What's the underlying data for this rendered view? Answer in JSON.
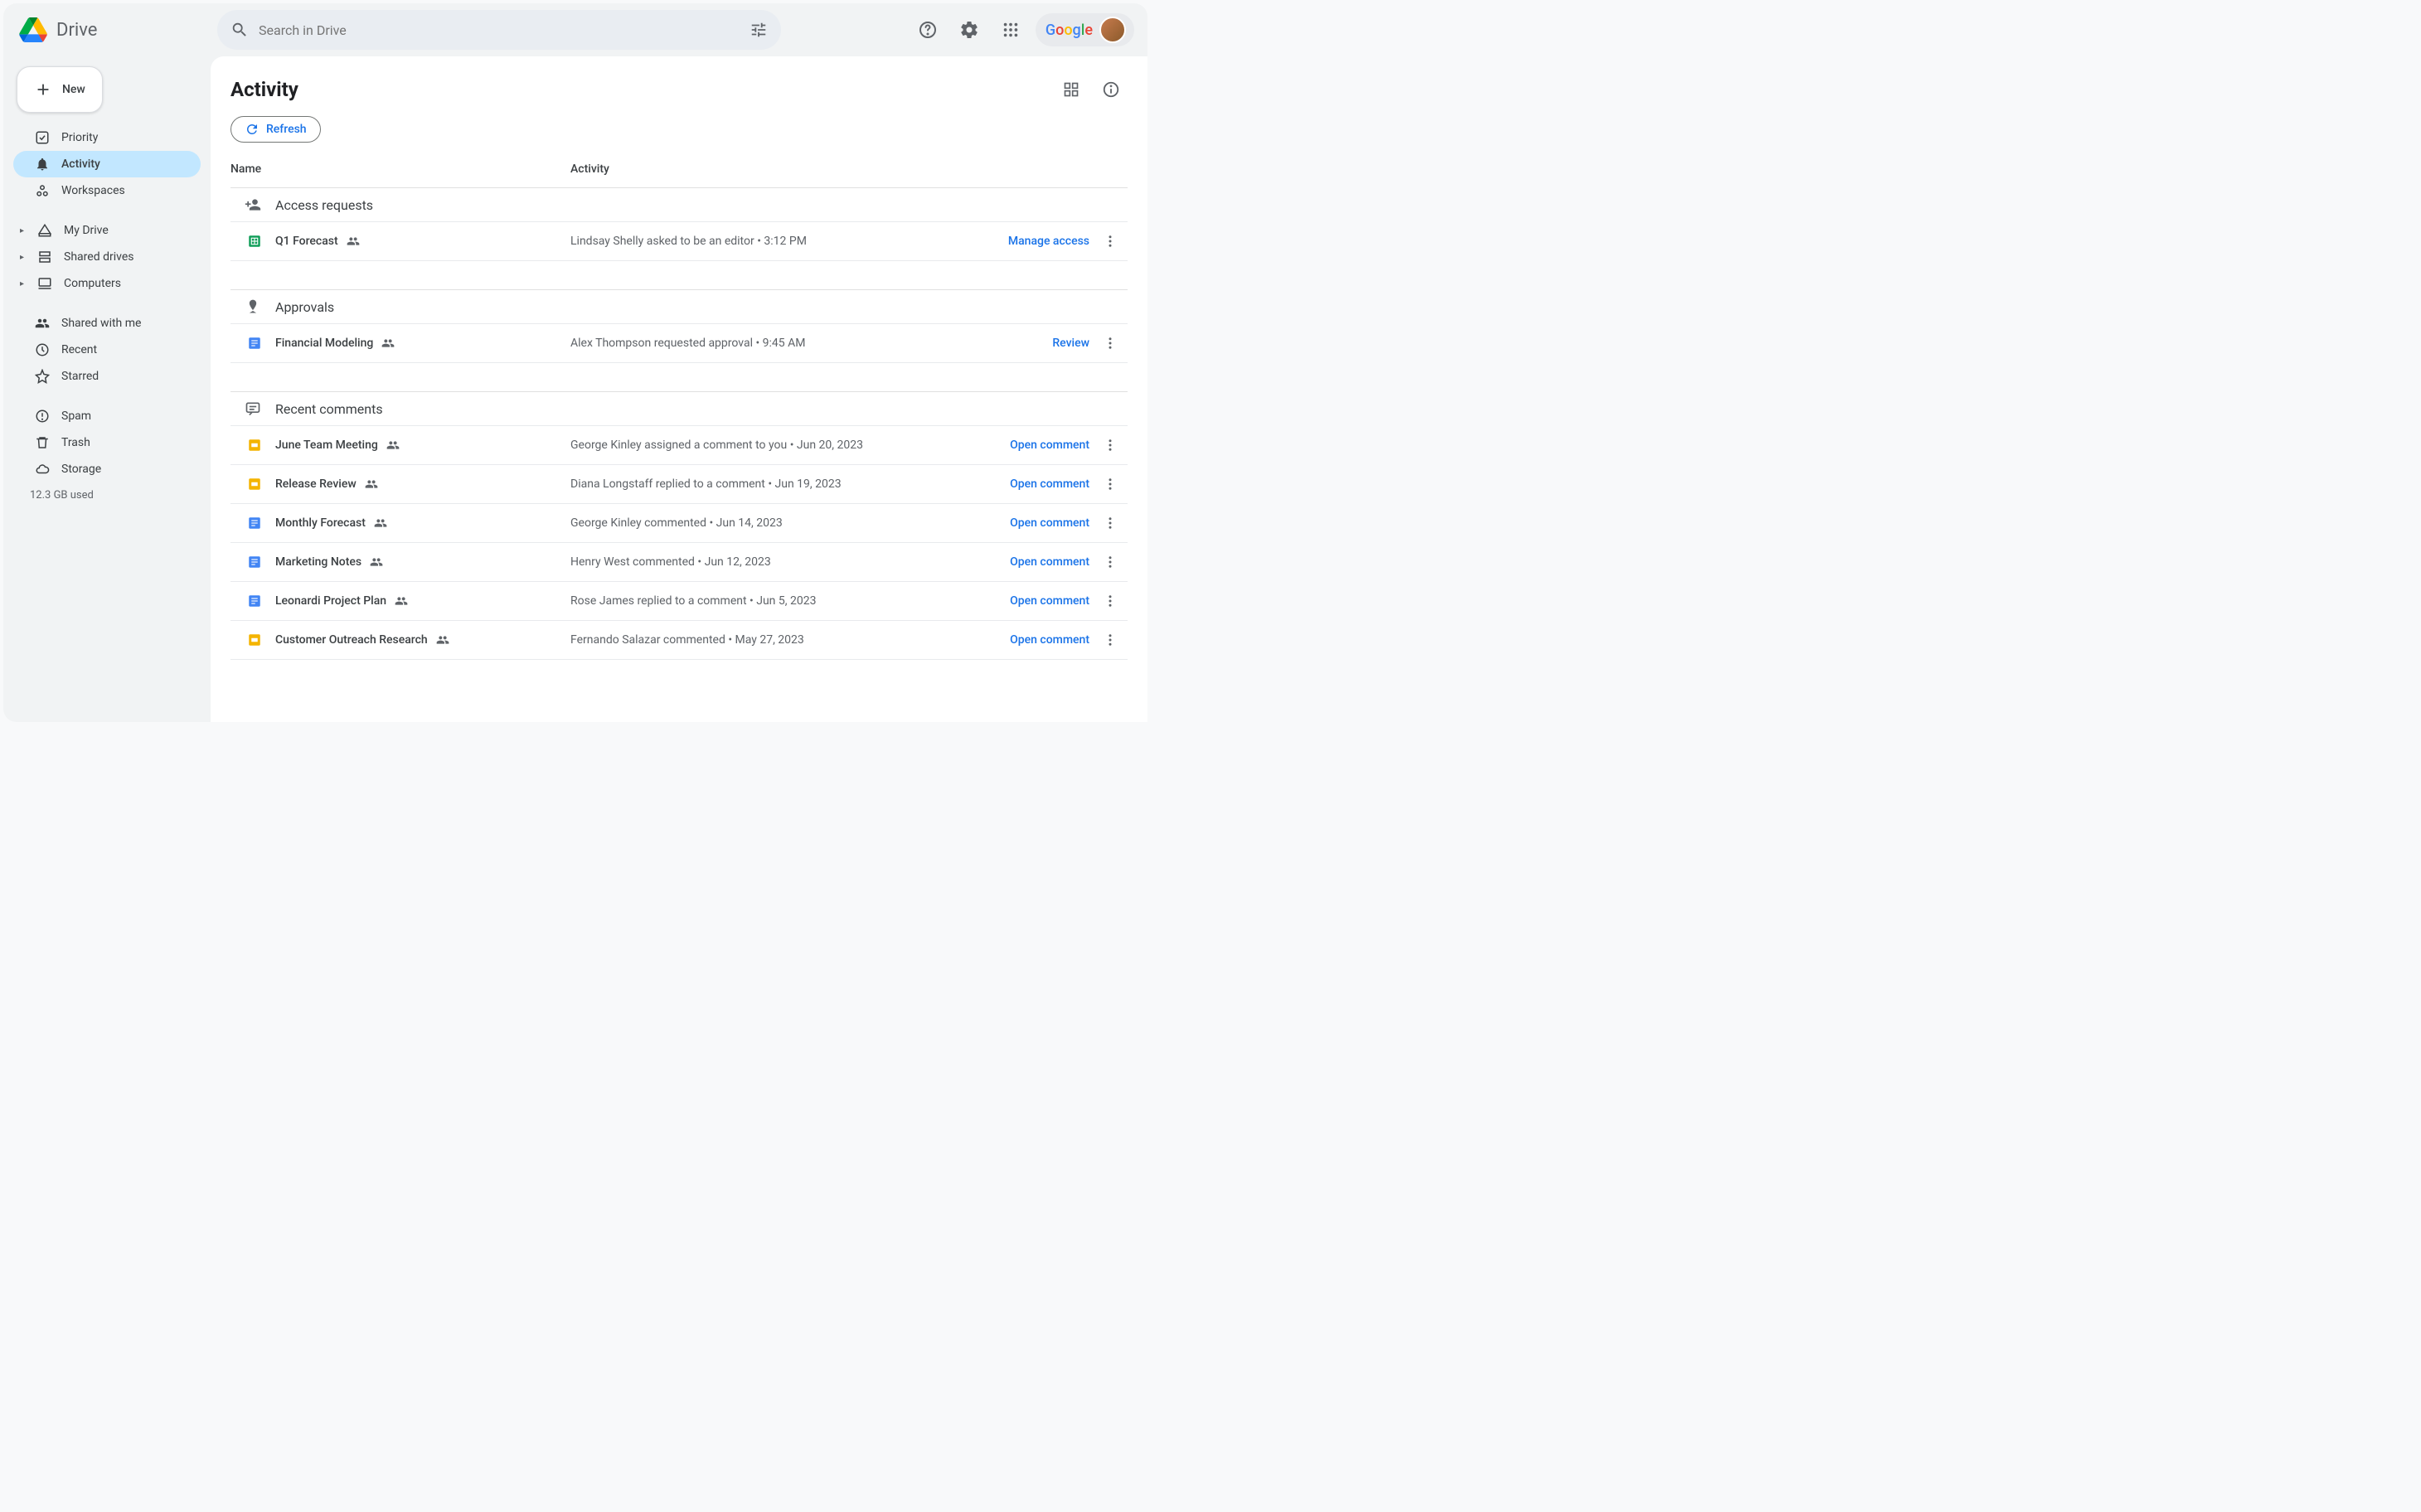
{
  "app_name": "Drive",
  "search_placeholder": "Search in Drive",
  "google_logo_text": "Google",
  "new_button_label": "New",
  "sidebar": {
    "items_top": [
      {
        "label": "Priority",
        "icon": "check-square"
      },
      {
        "label": "Activity",
        "icon": "bell",
        "active": true
      },
      {
        "label": "Workspaces",
        "icon": "workspaces"
      }
    ],
    "items_drives": [
      {
        "label": "My Drive",
        "icon": "my-drive",
        "expandable": true
      },
      {
        "label": "Shared drives",
        "icon": "shared-drives",
        "expandable": true
      },
      {
        "label": "Computers",
        "icon": "computer",
        "expandable": true
      }
    ],
    "items_other": [
      {
        "label": "Shared with me",
        "icon": "people"
      },
      {
        "label": "Recent",
        "icon": "clock"
      },
      {
        "label": "Starred",
        "icon": "star"
      }
    ],
    "items_bottom": [
      {
        "label": "Spam",
        "icon": "spam"
      },
      {
        "label": "Trash",
        "icon": "trash"
      },
      {
        "label": "Storage",
        "icon": "cloud"
      }
    ],
    "storage_used": "12.3 GB used"
  },
  "page_title": "Activity",
  "refresh_label": "Refresh",
  "columns": {
    "name": "Name",
    "activity": "Activity"
  },
  "sections": [
    {
      "title": "Access requests",
      "icon": "person-add",
      "rows": [
        {
          "file_type": "sheets",
          "file_name": "Q1 Forecast",
          "shared": true,
          "activity": "Lindsay Shelly asked to be an editor • 3:12 PM",
          "action": "Manage access"
        }
      ]
    },
    {
      "title": "Approvals",
      "icon": "approval",
      "rows": [
        {
          "file_type": "docs",
          "file_name": "Financial Modeling",
          "shared": true,
          "activity": "Alex Thompson requested approval • 9:45 AM",
          "action": "Review"
        }
      ]
    },
    {
      "title": "Recent comments",
      "icon": "comment",
      "rows": [
        {
          "file_type": "slides",
          "file_name": "June Team Meeting",
          "shared": true,
          "activity": "George Kinley assigned a comment to you • Jun 20, 2023",
          "action": "Open comment"
        },
        {
          "file_type": "slides",
          "file_name": "Release Review",
          "shared": true,
          "activity": "Diana Longstaff replied to a comment • Jun 19, 2023",
          "action": "Open comment"
        },
        {
          "file_type": "docs",
          "file_name": "Monthly Forecast",
          "shared": true,
          "activity": "George Kinley commented • Jun 14, 2023",
          "action": "Open comment"
        },
        {
          "file_type": "docs",
          "file_name": "Marketing Notes",
          "shared": true,
          "activity": "Henry West commented • Jun 12, 2023",
          "action": "Open comment"
        },
        {
          "file_type": "docs",
          "file_name": "Leonardi Project Plan",
          "shared": true,
          "activity": "Rose James replied to a comment • Jun 5, 2023",
          "action": "Open comment"
        },
        {
          "file_type": "slides",
          "file_name": "Customer Outreach Research",
          "shared": true,
          "activity": "Fernando Salazar commented • May 27, 2023",
          "action": "Open comment"
        }
      ]
    }
  ]
}
